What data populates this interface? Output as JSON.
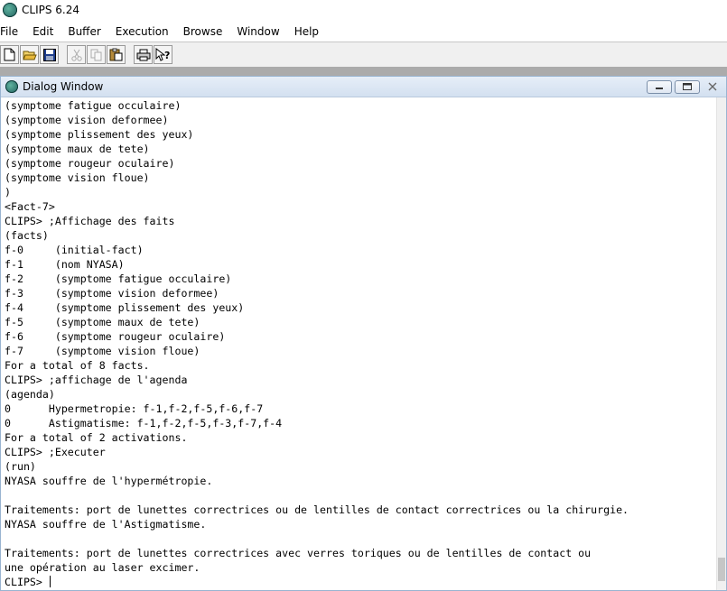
{
  "app": {
    "title": "CLIPS 6.24"
  },
  "menu": [
    "File",
    "Edit",
    "Buffer",
    "Execution",
    "Browse",
    "Window",
    "Help"
  ],
  "toolbar": {
    "buttons": [
      "new-file-icon",
      "open-folder-icon",
      "save-icon",
      "cut-icon",
      "copy-icon",
      "paste-icon",
      "print-icon",
      "help-pointer-icon"
    ]
  },
  "dialog": {
    "title": "Dialog Window",
    "lines": [
      "(symptome fatigue occulaire)",
      "(symptome vision deformee)",
      "(symptome plissement des yeux)",
      "(symptome maux de tete)",
      "(symptome rougeur oculaire)",
      "(symptome vision floue)",
      ")",
      "<Fact-7>",
      "CLIPS> ;Affichage des faits",
      "(facts)",
      "f-0     (initial-fact)",
      "f-1     (nom NYASA)",
      "f-2     (symptome fatigue occulaire)",
      "f-3     (symptome vision deformee)",
      "f-4     (symptome plissement des yeux)",
      "f-5     (symptome maux de tete)",
      "f-6     (symptome rougeur oculaire)",
      "f-7     (symptome vision floue)",
      "For a total of 8 facts.",
      "CLIPS> ;affichage de l'agenda",
      "(agenda)",
      "0      Hypermetropie: f-1,f-2,f-5,f-6,f-7",
      "0      Astigmatisme: f-1,f-2,f-5,f-3,f-7,f-4",
      "For a total of 2 activations.",
      "CLIPS> ;Executer",
      "(run)",
      "NYASA souffre de l'hypermétropie.",
      "",
      "Traitements: port de lunettes correctrices ou de lentilles de contact correctrices ou la chirurgie.",
      "NYASA souffre de l'Astigmatisme.",
      "",
      "Traitements: port de lunettes correctrices avec verres toriques ou de lentilles de contact ou",
      "une opération au laser excimer."
    ],
    "prompt": "CLIPS> "
  }
}
